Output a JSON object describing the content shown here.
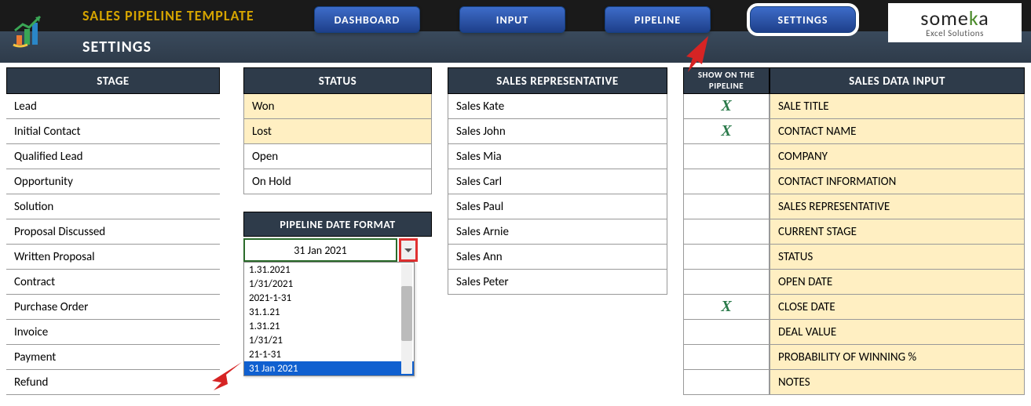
{
  "header": {
    "main_title": "SALES PIPELINE TEMPLATE",
    "subtitle": "SETTINGS",
    "nav": {
      "dashboard": "DASHBOARD",
      "input": "INPUT",
      "pipeline": "PIPELINE",
      "settings": "SETTINGS"
    },
    "brand": {
      "name_pre": "some",
      "name_k": "k",
      "name_post": "a",
      "tagline": "Excel Solutions"
    }
  },
  "columns": {
    "stage": {
      "header": "STAGE",
      "items": [
        "Lead",
        "Initial Contact",
        "Qualified Lead",
        "Opportunity",
        "Solution",
        "Proposal Discussed",
        "Written Proposal",
        "Contract",
        "Purchase Order",
        "Invoice",
        "Payment",
        "Refund"
      ]
    },
    "status": {
      "header": "STATUS",
      "items": [
        {
          "label": "Won",
          "highlight": true
        },
        {
          "label": "Lost",
          "highlight": true
        },
        {
          "label": "Open",
          "highlight": false
        },
        {
          "label": "On Hold",
          "highlight": false
        }
      ]
    },
    "date_format": {
      "header": "PIPELINE DATE FORMAT",
      "selected": "31 Jan 2021",
      "options": [
        "1.31.2021",
        "1/31/2021",
        "2021-1-31",
        "31.1.21",
        "1.31.21",
        "1/31/21",
        "21-1-31",
        "31 Jan 2021"
      ]
    },
    "rep": {
      "header": "SALES REPRESENTATIVE",
      "items": [
        "Sales Kate",
        "Sales John",
        "Sales Mia",
        "Sales Carl",
        "Sales Paul",
        "Sales Arnie",
        "Sales Ann",
        "Sales Peter"
      ]
    },
    "show": {
      "header": "SHOW ON THE PIPELINE",
      "marks": [
        "X",
        "X",
        "",
        "",
        "",
        "",
        "",
        "",
        "X",
        "",
        "",
        ""
      ]
    },
    "input": {
      "header": "SALES DATA INPUT",
      "items": [
        "SALE TITLE",
        "CONTACT NAME",
        "COMPANY",
        "CONTACT INFORMATION",
        "SALES REPRESENTATIVE",
        "CURRENT STAGE",
        "STATUS",
        "OPEN DATE",
        "CLOSE DATE",
        "DEAL VALUE",
        "PROBABILITY OF WINNING %",
        "NOTES"
      ]
    }
  }
}
